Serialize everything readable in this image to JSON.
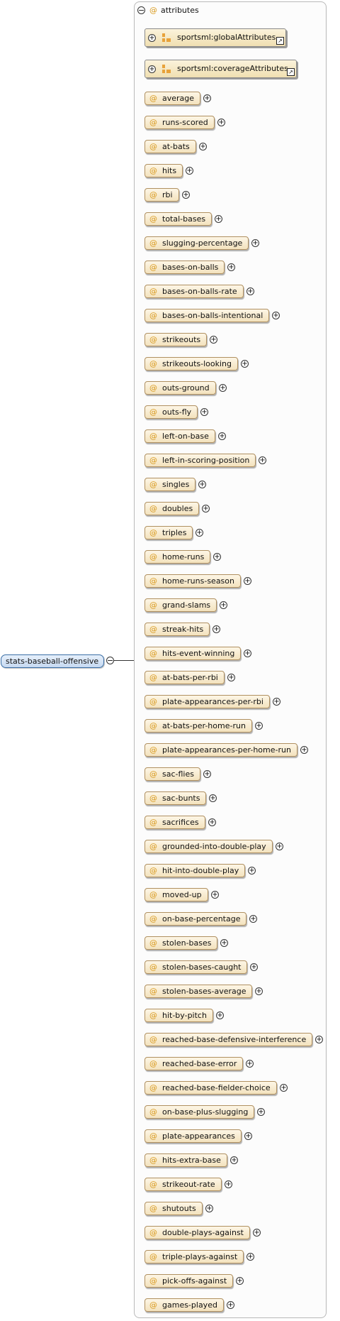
{
  "root": {
    "name": "stats-baseball-offensive",
    "toggle": "−"
  },
  "group": {
    "title": "attributes",
    "toggle": "−",
    "at_symbol": "@"
  },
  "refs": [
    {
      "name": "sportsml:globalAttributes",
      "plus": "+",
      "link": "↗"
    },
    {
      "name": "sportsml:coverageAttributes",
      "plus": "+",
      "link": "↗"
    }
  ],
  "attributes": [
    "average",
    "runs-scored",
    "at-bats",
    "hits",
    "rbi",
    "total-bases",
    "slugging-percentage",
    "bases-on-balls",
    "bases-on-balls-rate",
    "bases-on-balls-intentional",
    "strikeouts",
    "strikeouts-looking",
    "outs-ground",
    "outs-fly",
    "left-on-base",
    "left-in-scoring-position",
    "singles",
    "doubles",
    "triples",
    "home-runs",
    "home-runs-season",
    "grand-slams",
    "streak-hits",
    "hits-event-winning",
    "at-bats-per-rbi",
    "plate-appearances-per-rbi",
    "at-bats-per-home-run",
    "plate-appearances-per-home-run",
    "sac-flies",
    "sac-bunts",
    "sacrifices",
    "grounded-into-double-play",
    "hit-into-double-play",
    "moved-up",
    "on-base-percentage",
    "stolen-bases",
    "stolen-bases-caught",
    "stolen-bases-average",
    "hit-by-pitch",
    "reached-base-defensive-interference",
    "reached-base-error",
    "reached-base-fielder-choice",
    "on-base-plus-slugging",
    "plate-appearances",
    "hits-extra-base",
    "strikeout-rate",
    "shutouts",
    "double-plays-against",
    "triple-plays-against",
    "pick-offs-against",
    "games-played"
  ],
  "attr_plus": "+",
  "colors": {
    "attr_fill": "#f3e2bd",
    "at_symbol": "#d99a1e",
    "root_fill": "#c6d9f1",
    "root_border": "#3a6ea5"
  }
}
